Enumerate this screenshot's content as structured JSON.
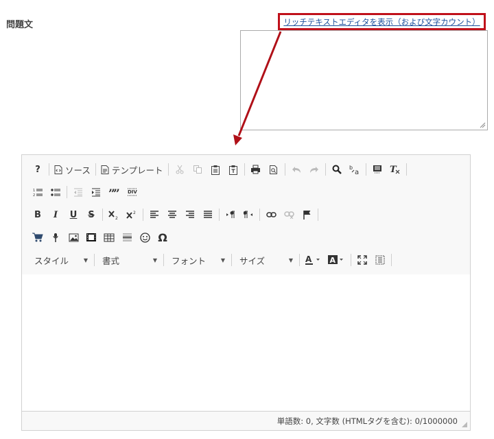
{
  "field": {
    "label": "問題文"
  },
  "toggle": {
    "text": "リッチテキストエディタを表示（および文字カウント）"
  },
  "toolbar": {
    "help": "?",
    "source": "ソース",
    "templates": "テンプレート",
    "bold": "B",
    "italic": "I",
    "underline": "U",
    "strike": "S",
    "special_char": "Ω",
    "combos": {
      "style": "スタイル",
      "format": "書式",
      "font": "フォント",
      "size": "サイズ"
    }
  },
  "footer": {
    "count": "単語数: 0, 文字数 (HTMLタグを含む): 0/1000000"
  },
  "colors": {
    "highlight_border": "#c0101a",
    "link": "#1b4f9c",
    "arrow": "#b01018"
  }
}
